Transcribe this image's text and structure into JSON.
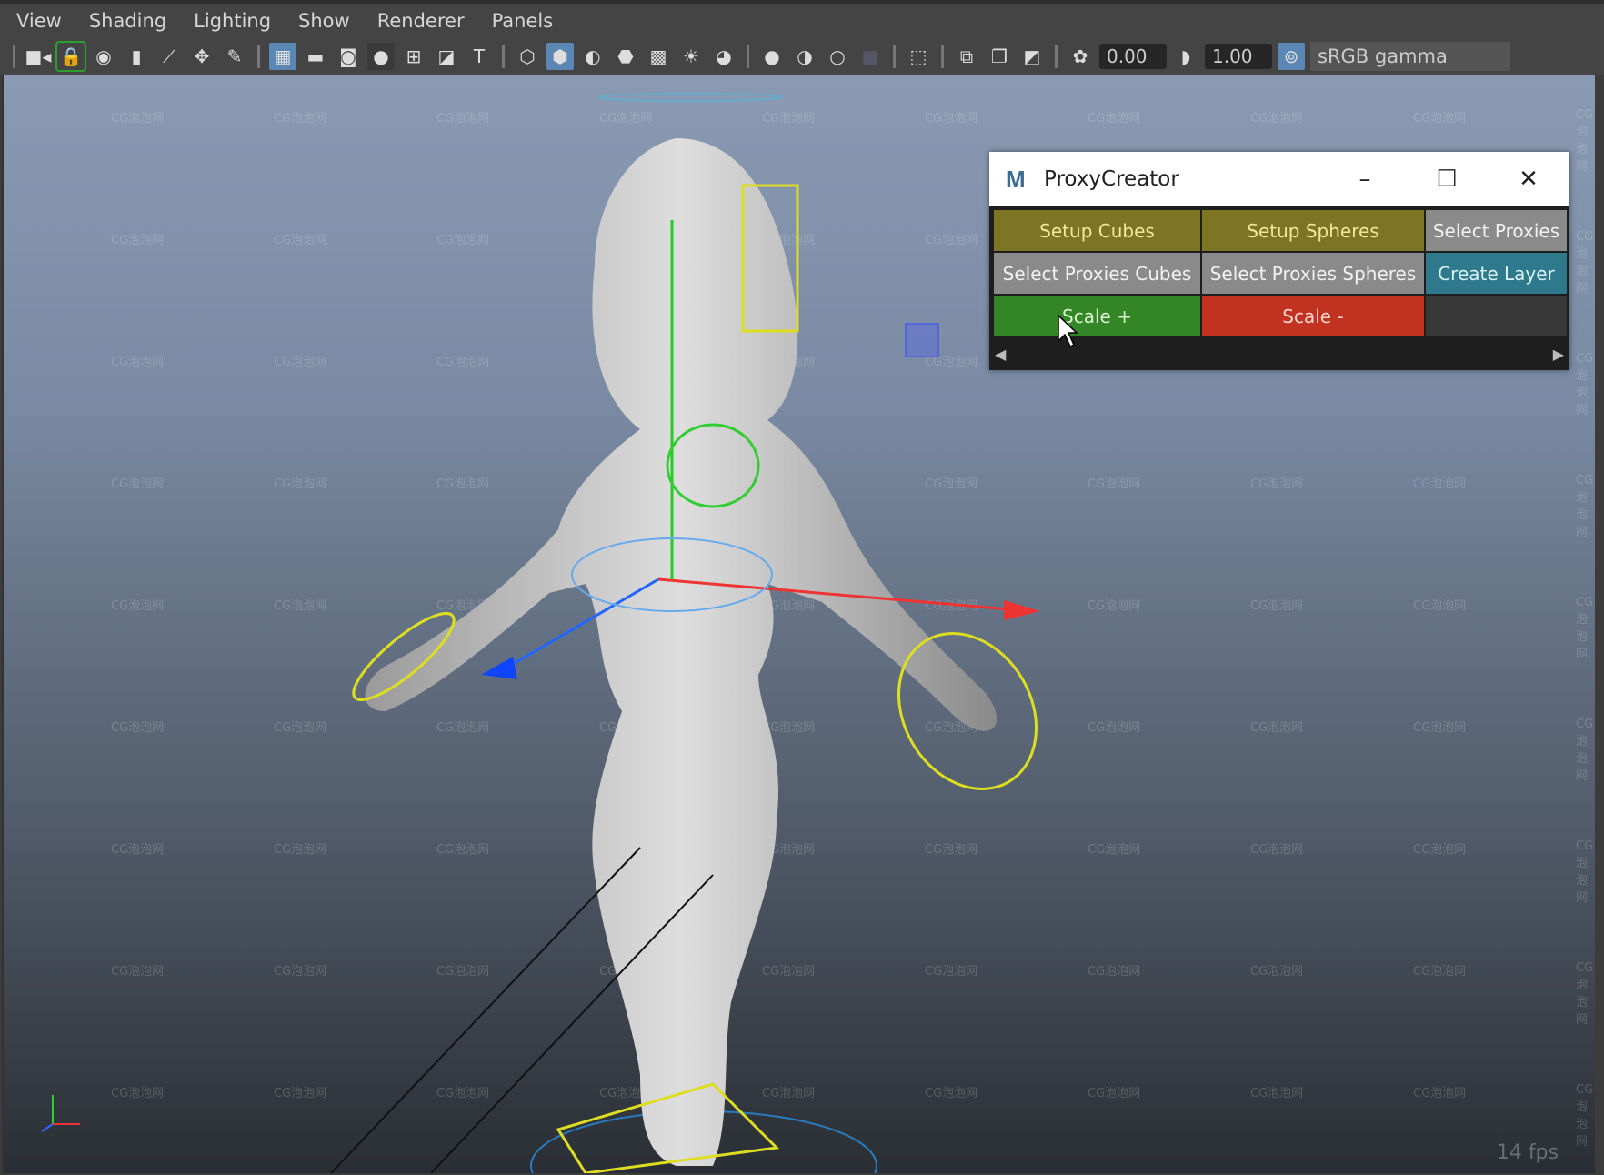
{
  "menubar": {
    "items": [
      "View",
      "Shading",
      "Lighting",
      "Show",
      "Renderer",
      "Panels"
    ]
  },
  "toolbar": {
    "exposure": "0.00",
    "gamma": "1.00",
    "color_space": "sRGB gamma",
    "icons": [
      "camera-icon",
      "lock-camera-icon",
      "camera-attributes-icon",
      "bookmark-icon",
      "image-plane-icon",
      "2d-pan-icon",
      "grease-pencil-icon",
      "grid-icon",
      "film-gate-icon",
      "resolution-gate-icon",
      "gate-mask-icon",
      "field-chart-icon",
      "safe-action-icon",
      "safe-title-icon",
      "wireframe-icon",
      "smooth-shade-icon",
      "default-material-icon",
      "wireframe-on-shaded-icon",
      "textured-icon",
      "lights-icon",
      "shadows-icon",
      "screen-space-ao-icon",
      "motion-blur-icon",
      "antialiasing-icon",
      "depth-of-field-icon",
      "isolate-select-icon",
      "xray-icon",
      "xray-joints-icon",
      "xray-components-icon",
      "exposure-icon",
      "gamma-icon",
      "color-management-icon"
    ]
  },
  "dialog": {
    "title": "ProxyCreator",
    "logo": "M",
    "buttons": [
      {
        "label": "Setup Cubes",
        "color": "#7e7524",
        "text": "#efe9a0"
      },
      {
        "label": "Setup Spheres",
        "color": "#7e7524",
        "text": "#efe9a0"
      },
      {
        "label": "Select Proxies",
        "color": "#8a8a8a",
        "text": "#f2f2f2"
      },
      {
        "label": "Select Proxies Cubes",
        "color": "#8a8a8a",
        "text": "#f2f2f2"
      },
      {
        "label": "Select Proxies Spheres",
        "color": "#8a8a8a",
        "text": "#f2f2f2"
      },
      {
        "label": "Create Layer",
        "color": "#2e7a8c",
        "text": "#d8f2f8"
      },
      {
        "label": "Scale +",
        "color": "#338526",
        "text": "#d8f5cf"
      },
      {
        "label": "Scale -",
        "color": "#c23220",
        "text": "#fbd6cc"
      },
      {
        "label": "",
        "color": "#383838",
        "text": "#fff"
      }
    ]
  },
  "viewport": {
    "fps": "14 fps",
    "watermark": "CG泡泡网",
    "axis": {
      "y": "y",
      "x": "x",
      "z": "z"
    }
  }
}
